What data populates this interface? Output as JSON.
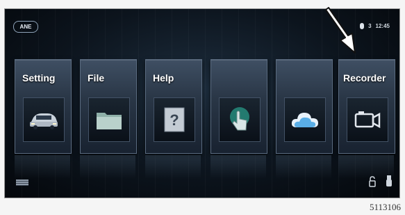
{
  "screen": {
    "brand_badge": "ANE",
    "status_time": "12:45",
    "status_signal": "3"
  },
  "tiles": [
    {
      "label": "Setting",
      "icon": "car-icon"
    },
    {
      "label": "File",
      "icon": "folder-icon"
    },
    {
      "label": "Help",
      "icon": "help-icon"
    },
    {
      "label": "",
      "icon": "touch-icon"
    },
    {
      "label": "",
      "icon": "cloud-icon"
    },
    {
      "label": "Recorder",
      "icon": "camera-icon"
    }
  ],
  "figure_id": "5113106",
  "colors": {
    "screen_bg": "#0c141d",
    "tile_bg": "#2a3747",
    "touch_icon": "#2e9a8a",
    "cloud_icon": "#4fa3e0",
    "label": "#ffffff"
  }
}
